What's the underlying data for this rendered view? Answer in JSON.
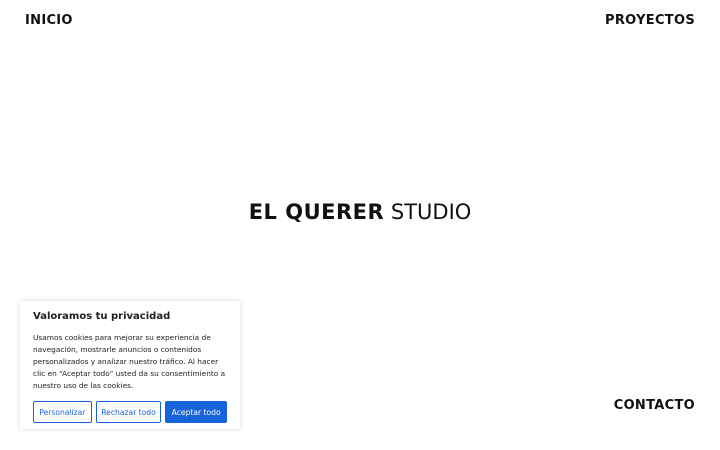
{
  "nav": {
    "inicio": "INICIO",
    "proyectos": "PROYECTOS",
    "contacto": "CONTACTO"
  },
  "brand": {
    "bold": "EL QUERER",
    "light": "STUDIO"
  },
  "cookie": {
    "title": "Valoramos tu privacidad",
    "text": "Usamos cookies para mejorar su experiencia de navegación, mostrarle anuncios o contenidos personalizados y analizar nuestro tráfico. Al hacer clic en “Aceptar todo” usted da su consentimiento a nuestro uso de las cookies.",
    "customize_label": "Personalizar",
    "reject_label": "Rechazar todo",
    "accept_label": "Aceptar todo"
  },
  "colors": {
    "accent": "#1863dc",
    "text": "#111111",
    "background": "#ffffff"
  }
}
